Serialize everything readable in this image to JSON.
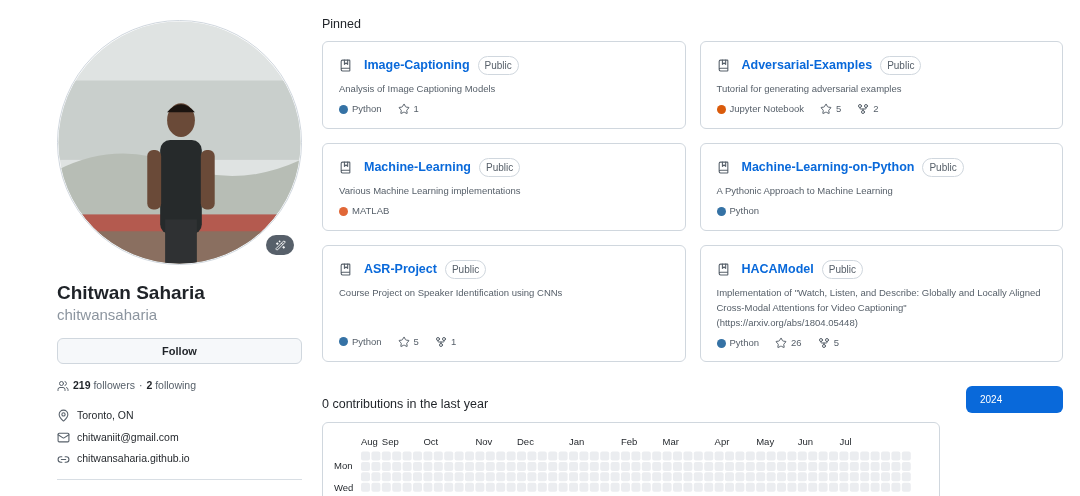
{
  "profile": {
    "name": "Chitwan Saharia",
    "username": "chitwansaharia",
    "follow_button": "Follow",
    "followers_count": "219",
    "followers_label": "followers",
    "separator": "·",
    "following_count": "2",
    "following_label": "following",
    "details": [
      {
        "kind": "location",
        "text": "Toronto, ON"
      },
      {
        "kind": "email",
        "text": "chitwaniit@gmail.com"
      },
      {
        "kind": "link",
        "text": "chitwansaharia.github.io"
      }
    ]
  },
  "pinned": {
    "title": "Pinned",
    "repos": [
      {
        "name": "Image-Captioning",
        "visibility": "Public",
        "description": "Analysis of Image Captioning Models",
        "language": "Python",
        "color": "#3572a5",
        "stars": "1"
      },
      {
        "name": "Adversarial-Examples",
        "visibility": "Public",
        "description": "Tutorial for generating adversarial examples",
        "language": "Jupyter Notebook",
        "color": "#da5b0b",
        "stars": "5",
        "forks": "2"
      },
      {
        "name": "Machine-Learning",
        "visibility": "Public",
        "description": "Various Machine Learning implementations",
        "language": "MATLAB",
        "color": "#e16737"
      },
      {
        "name": "Machine-Learning-on-Python",
        "visibility": "Public",
        "description": "A Pythonic Approach to Machine Learning",
        "language": "Python",
        "color": "#3572a5"
      },
      {
        "name": "ASR-Project",
        "visibility": "Public",
        "description": "Course Project on Speaker Identification using CNNs",
        "language": "Python",
        "color": "#3572a5",
        "stars": "5",
        "forks": "1"
      },
      {
        "name": "HACAModel",
        "visibility": "Public",
        "description": "Implementation of \"Watch, Listen, and Describe: Globally and Locally Aligned Cross-Modal Attentions for Video Captioning\" (https://arxiv.org/abs/1804.05448)",
        "language": "Python",
        "color": "#3572a5",
        "stars": "26",
        "forks": "5"
      }
    ]
  },
  "contributions": {
    "title": "0 contributions in the last year",
    "months": [
      "Aug",
      "Sep",
      "Oct",
      "Nov",
      "Dec",
      "Jan",
      "Feb",
      "Mar",
      "Apr",
      "May",
      "Jun",
      "Jul"
    ],
    "days": [
      "Mon",
      "Wed"
    ],
    "years": [
      {
        "label": "2024",
        "selected": true
      }
    ]
  }
}
